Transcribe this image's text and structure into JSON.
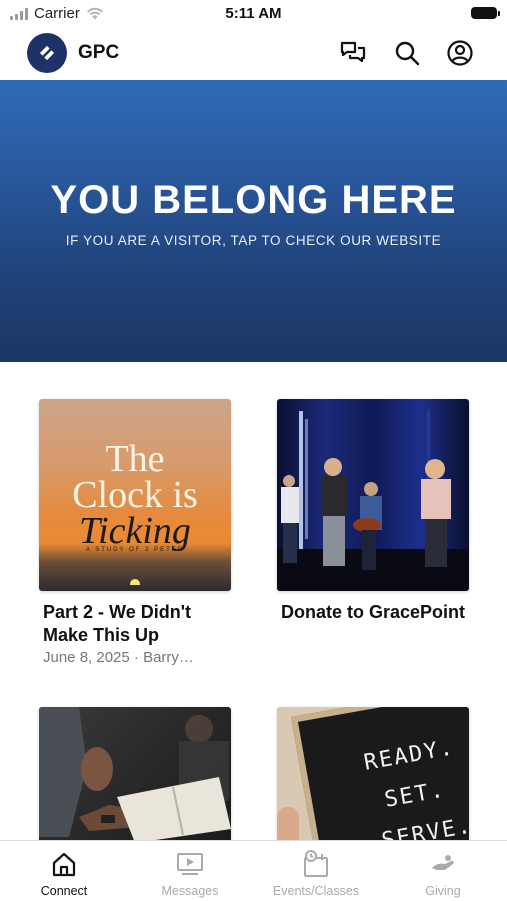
{
  "status_bar": {
    "carrier": "Carrier",
    "time": "5:11 AM"
  },
  "header": {
    "title": "GPC",
    "icons": [
      "chat-icon",
      "search-icon",
      "profile-icon"
    ]
  },
  "hero": {
    "title": "YOU BELONG HERE",
    "subtitle": "IF YOU ARE A VISITOR, TAP TO CHECK OUR WEBSITE"
  },
  "cards": [
    {
      "title": "Part 2 - We Didn't Make This Up",
      "meta": "June 8, 2025 · Barry…",
      "thumb": {
        "line1": "The",
        "line2": "Clock is",
        "line3": "Ticking",
        "line4": "A STUDY OF 2 PETER"
      }
    },
    {
      "title": "Donate to GracePoint",
      "meta": ""
    },
    {
      "title": "",
      "meta": ""
    },
    {
      "title": "",
      "meta": "",
      "thumb": {
        "line1": "READY.",
        "line2": "SET.",
        "line3": "SERVE."
      }
    }
  ],
  "tabs": [
    {
      "label": "Connect",
      "icon": "home-icon",
      "active": true
    },
    {
      "label": "Messages",
      "icon": "video-icon",
      "active": false
    },
    {
      "label": "Events/Classes",
      "icon": "calendar-clock-icon",
      "active": false
    },
    {
      "label": "Giving",
      "icon": "giving-hand-icon",
      "active": false
    }
  ],
  "colors": {
    "brand": "#1f3268",
    "hero_top": "#2f6cb6",
    "hero_bottom": "#1c3463",
    "tab_active": "#111111",
    "tab_inactive": "#aaaaaa"
  }
}
